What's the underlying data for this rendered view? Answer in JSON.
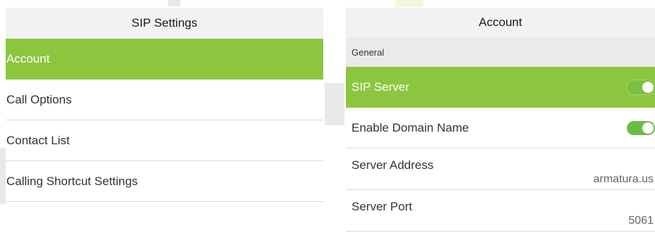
{
  "left_panel": {
    "title": "SIP Settings",
    "items": [
      {
        "label": "Account",
        "active": true
      },
      {
        "label": "Call Options",
        "active": false
      },
      {
        "label": "Contact List",
        "active": false
      },
      {
        "label": "Calling Shortcut Settings",
        "active": false
      }
    ]
  },
  "right_panel": {
    "title": "Account",
    "section": "General",
    "sip_server": {
      "label": "SIP Server",
      "on": true
    },
    "enable_domain": {
      "label": "Enable Domain Name",
      "on": true
    },
    "server_address": {
      "label": "Server Address",
      "value": "armatura.us"
    },
    "server_port": {
      "label": "Server Port",
      "value": "5061"
    }
  },
  "colors": {
    "accent": "#8cc63f",
    "toggle_on": "#6dbb47",
    "header_bg": "#f2f2f2",
    "section_bg": "#eaeaea"
  }
}
